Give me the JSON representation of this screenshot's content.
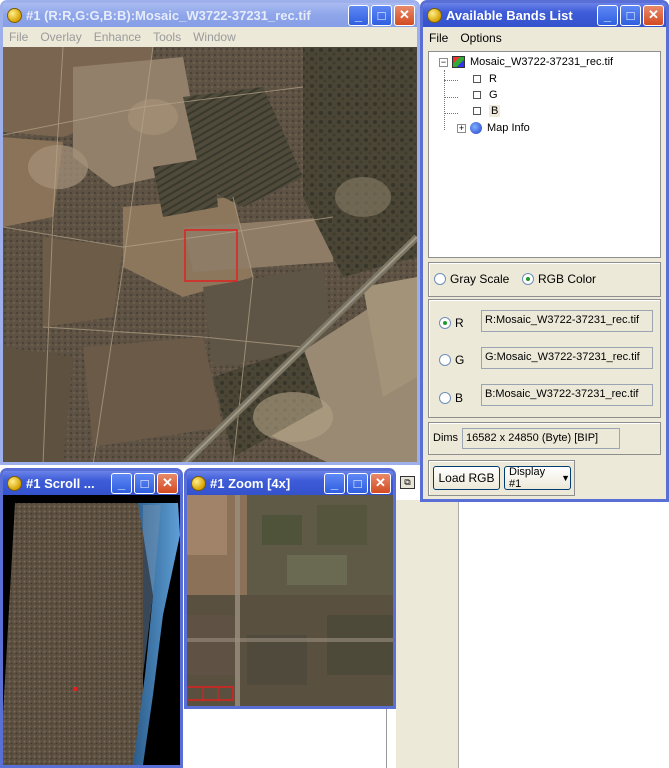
{
  "image_window": {
    "title": "#1 (R:R,G:G,B:B):Mosaic_W3722-37231_rec.tif",
    "menu": [
      "File",
      "Overlay",
      "Enhance",
      "Tools",
      "Window"
    ]
  },
  "scroll_window": {
    "title": "#1 Scroll ..."
  },
  "zoom_window": {
    "title": "#1 Zoom [4x]"
  },
  "bands_window": {
    "title": "Available Bands List",
    "menu": [
      "File",
      "Options"
    ],
    "tree": {
      "file_name": "Mosaic_W3722-37231_rec.tif",
      "bands": [
        "R",
        "G",
        "B"
      ],
      "map_info": "Map Info"
    },
    "mode": {
      "gray_scale": "Gray Scale",
      "rgb_color": "RGB Color",
      "selected": "RGB Color"
    },
    "channels": [
      {
        "label": "R",
        "value": "R:Mosaic_W3722-37231_rec.tif",
        "selected": true
      },
      {
        "label": "G",
        "value": "G:Mosaic_W3722-37231_rec.tif",
        "selected": false
      },
      {
        "label": "B",
        "value": "B:Mosaic_W3722-37231_rec.tif",
        "selected": false
      }
    ],
    "dims_label": "Dims",
    "dims_value": "16582 x 24850 (Byte) [BIP]",
    "load_button": "Load RGB",
    "display_select": "Display #1"
  },
  "colors": {
    "title_active": "#3e5cd8",
    "title_inactive": "#8ea5ea",
    "close": "#d34b22",
    "panel": "#ece9d8",
    "selection_box": "#e02020"
  }
}
